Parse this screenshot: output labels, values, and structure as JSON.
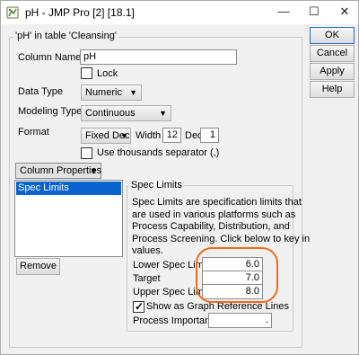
{
  "window": {
    "title": "pH - JMP Pro [2] [18.1]",
    "controls": {
      "minimize": "—",
      "maximize": "☐",
      "close": "✕"
    }
  },
  "main_group": {
    "legend": "'pH' in table 'Cleansing'"
  },
  "column_name": {
    "label": "Column Name",
    "value": "pH"
  },
  "lock": {
    "label": "Lock",
    "checked": false
  },
  "data_type": {
    "label": "Data Type",
    "value": "Numeric"
  },
  "modeling_type": {
    "label": "Modeling Type",
    "value": "Continuous"
  },
  "format": {
    "label": "Format",
    "value": "Fixed Dec",
    "width_label": "Width",
    "width_value": "12",
    "dec_label": "Dec",
    "dec_value": "1"
  },
  "thousands": {
    "label": "Use thousands separator (,)",
    "checked": false
  },
  "column_properties": {
    "label": "Column Properties",
    "items": [
      "Spec Limits"
    ],
    "selected": "Spec Limits",
    "remove_label": "Remove"
  },
  "spec_limits": {
    "legend": "Spec Limits",
    "description_lines": [
      "Spec Limits are specification limits that",
      "are used in various platforms such as",
      "Process Capability, Distribution, and",
      "Process Screening. Click below to key in",
      "values."
    ],
    "lower_label": "Lower Spec Limit",
    "lower_value": "6.0",
    "target_label": "Target",
    "target_value": "7.0",
    "upper_label": "Upper Spec Limit",
    "upper_value": "8.0",
    "show_ref_label": "Show as Graph Reference Lines",
    "show_ref_checked": true,
    "importance_label": "Process Importance",
    "importance_value": "."
  },
  "buttons": {
    "ok": "OK",
    "cancel": "Cancel",
    "apply": "Apply",
    "help": "Help"
  },
  "colors": {
    "highlight": "#f26a1b",
    "selection": "#0a64d0"
  }
}
